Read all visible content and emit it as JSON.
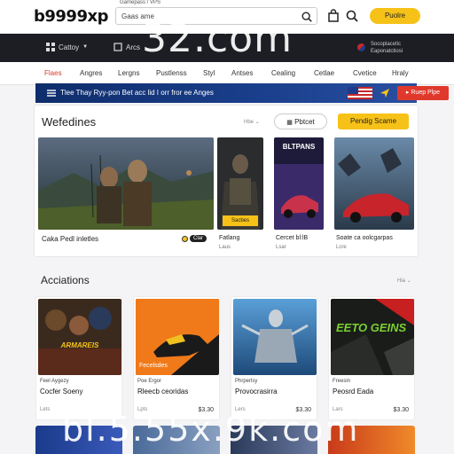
{
  "header": {
    "logo": "b9999xp",
    "search_label": "Gamepass / VPS",
    "search_value": "Gaas ame",
    "cta_label": "Puolre"
  },
  "darkbar": {
    "category_label": "Cattoy",
    "second_label": "Arcs",
    "account_line1": "Socoplacetic",
    "account_line2": "Eaponatctiosi"
  },
  "watermark": {
    "top": "32.com",
    "bottom": "bl.5.55x.9k.com"
  },
  "nav": {
    "items": [
      "Flaes",
      "Angres",
      "Lergns",
      "Pustlenss",
      "Styl",
      "Antses",
      "Cealing",
      "Cetlae",
      "Cvetice",
      "Hraly"
    ]
  },
  "promo": {
    "text": "Tlee Thay Ryy-pon Bet acc lid I orr fror ee Anges",
    "button": "Ruep Plpe"
  },
  "featured": {
    "title": "Wefedines",
    "sort": "Hbe",
    "button1": "Pbtcet",
    "button2": "Pendig Scame",
    "main_caption": "Caka Pedl inletles",
    "main_sub": "",
    "rating_label": "Clar",
    "cards": [
      {
        "caption": "Fatlang",
        "sub": "Laus",
        "tag": "Sacbes"
      },
      {
        "caption": "Cercet bl:lB",
        "sub": "Lsar",
        "title_art": "BLTPANS"
      },
      {
        "caption": "Soate ca oolcgarpas",
        "sub": "Lcre"
      }
    ]
  },
  "actions": {
    "title": "Acciations",
    "sort": "Hia",
    "cards": [
      {
        "line1": "Feel Aygezy",
        "line2": "Cocfer Soeny",
        "rating": "Lets",
        "price": "",
        "art": "ARMAREIS"
      },
      {
        "line1": "Poe Ergor",
        "line2": "Rleecb ceoridas",
        "rating": "Lpts",
        "price": "$3.30",
        "art": "Fecelsdes"
      },
      {
        "line1": "Phrperlsy",
        "line2": "Provocrasirra",
        "rating": "Lers",
        "price": "$3.30"
      },
      {
        "line1": "Freesin",
        "line2": "Peosrd Eada",
        "rating": "Lars",
        "price": "$3.30",
        "art": "EETO GEINS"
      }
    ]
  },
  "colors": {
    "accent_yellow": "#f7c218",
    "accent_red": "#e0392b",
    "dark_header": "#1c1e24",
    "promo_blue": "#1a3f8c"
  }
}
